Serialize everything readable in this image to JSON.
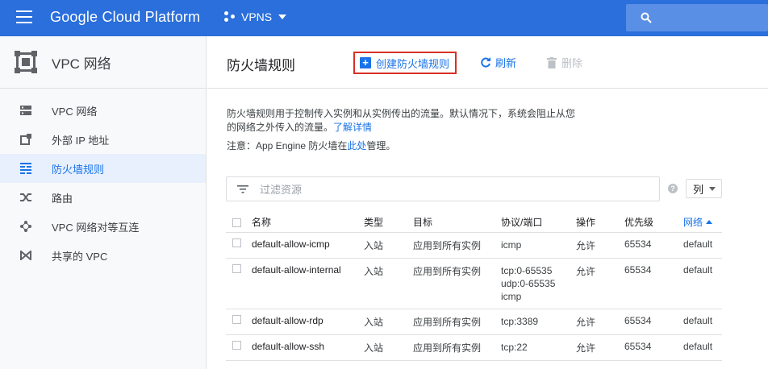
{
  "topbar": {
    "brand": "Google Cloud Platform",
    "project": "VPNS",
    "accent": "#2a6fdb"
  },
  "sidebar": {
    "title": "VPC 网络",
    "items": [
      {
        "label": "VPC 网络",
        "icon": "vpc-network-icon",
        "active": false
      },
      {
        "label": "外部 IP 地址",
        "icon": "external-ip-icon",
        "active": false
      },
      {
        "label": "防火墙规则",
        "icon": "firewall-icon",
        "active": true
      },
      {
        "label": "路由",
        "icon": "routes-icon",
        "active": false
      },
      {
        "label": "VPC 网络对等互连",
        "icon": "peering-icon",
        "active": false
      },
      {
        "label": "共享的 VPC",
        "icon": "shared-vpc-icon",
        "active": false
      }
    ]
  },
  "main": {
    "title": "防火墙规则",
    "create_label": "创建防火墙规则",
    "refresh_label": "刷新",
    "delete_label": "删除",
    "desc_line1": "防火墙规则用于控制传入实例和从实例传出的流量。默认情况下，系统会阻止从您",
    "desc_line2": "的网络之外传入的流量。",
    "learn_more": "了解详情",
    "note_prefix": "注意：App Engine 防火墙在",
    "note_link": "此处",
    "note_suffix": "管理。",
    "filter_placeholder": "过滤资源",
    "columns_label": "列"
  },
  "table": {
    "headers": {
      "name": "名称",
      "type": "类型",
      "target": "目标",
      "ports": "协议/端口",
      "action": "操作",
      "priority": "优先级",
      "network": "网络"
    },
    "rows": [
      {
        "name": "default-allow-icmp",
        "type": "入站",
        "target": "应用到所有实例",
        "ports": [
          "icmp"
        ],
        "action": "允许",
        "priority": "65534",
        "network": "default"
      },
      {
        "name": "default-allow-internal",
        "type": "入站",
        "target": "应用到所有实例",
        "ports": [
          "tcp:0-65535",
          "udp:0-65535",
          "icmp"
        ],
        "action": "允许",
        "priority": "65534",
        "network": "default"
      },
      {
        "name": "default-allow-rdp",
        "type": "入站",
        "target": "应用到所有实例",
        "ports": [
          "tcp:3389"
        ],
        "action": "允许",
        "priority": "65534",
        "network": "default"
      },
      {
        "name": "default-allow-ssh",
        "type": "入站",
        "target": "应用到所有实例",
        "ports": [
          "tcp:22"
        ],
        "action": "允许",
        "priority": "65534",
        "network": "default"
      }
    ]
  }
}
